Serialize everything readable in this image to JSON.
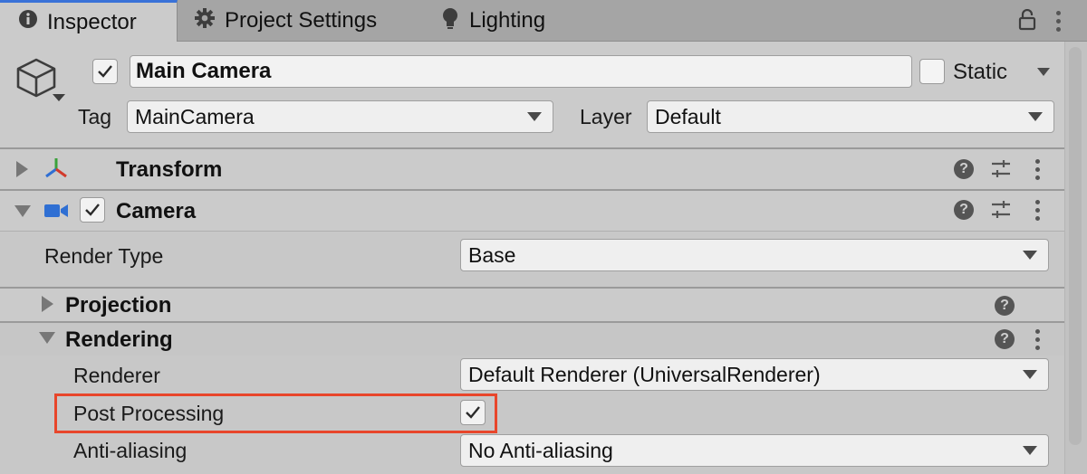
{
  "tabs": [
    {
      "label": "Inspector",
      "icon": "info-icon",
      "active": true
    },
    {
      "label": "Project Settings",
      "icon": "gear-icon",
      "active": false
    },
    {
      "label": "Lighting",
      "icon": "lightbulb-icon",
      "active": false
    }
  ],
  "header": {
    "object_name": "Main Camera",
    "active_checked": true,
    "static_label": "Static",
    "static_checked": false,
    "tag_label": "Tag",
    "tag_value": "MainCamera",
    "layer_label": "Layer",
    "layer_value": "Default"
  },
  "components": {
    "transform": {
      "title": "Transform"
    },
    "camera": {
      "title": "Camera",
      "enabled": true
    }
  },
  "camera": {
    "render_type_label": "Render Type",
    "render_type_value": "Base",
    "projection_label": "Projection",
    "rendering_label": "Rendering",
    "renderer_label": "Renderer",
    "renderer_value": "Default Renderer (UniversalRenderer)",
    "post_processing_label": "Post Processing",
    "post_processing_checked": true,
    "anti_aliasing_label": "Anti-aliasing",
    "anti_aliasing_value": "No Anti-aliasing"
  },
  "colors": {
    "active_tab_accent": "#3a72d8",
    "highlight": "#e8462b",
    "camera_icon": "#2f6fd3"
  }
}
